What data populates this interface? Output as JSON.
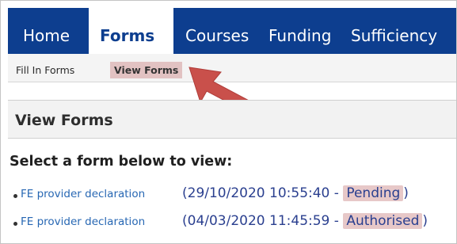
{
  "nav": {
    "tabs": [
      {
        "label": "Home"
      },
      {
        "label": "Forms"
      },
      {
        "label": "Courses"
      },
      {
        "label": "Funding"
      },
      {
        "label": "Sufficiency"
      }
    ],
    "active": "Forms"
  },
  "subnav": {
    "items": [
      {
        "label": "Fill In Forms"
      },
      {
        "label": "View Forms"
      }
    ],
    "active": "View Forms"
  },
  "panel": {
    "title": "View Forms"
  },
  "prompt": "Select a form below to view:",
  "forms": [
    {
      "name": "FE provider declaration",
      "date": "(29/10/2020 10:55:40 - ",
      "status": "Pending",
      "suffix": ")"
    },
    {
      "name": "FE provider declaration",
      "date": "(04/03/2020 11:45:59 - ",
      "status": "Authorised",
      "suffix": ")"
    }
  ],
  "colors": {
    "nav_bg": "#0d3e8f",
    "highlight": "#e2c2c2",
    "arrow": "#c9504b",
    "link": "#2767b3"
  },
  "icons": {
    "annotation": "red-arrow-icon"
  }
}
